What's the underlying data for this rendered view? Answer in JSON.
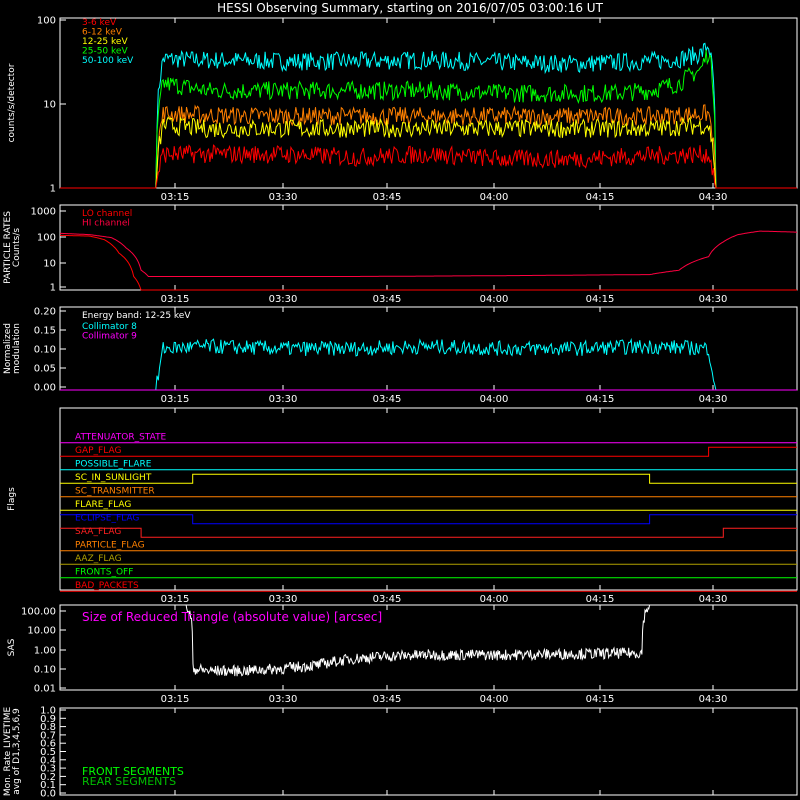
{
  "title": "HESSI Observing Summary, starting on 2016/07/05 03:00:16 UT",
  "colors": {
    "background": "#000000",
    "axes": "#ffffff",
    "red": "#ff0000",
    "orange": "#ff8000",
    "yellow": "#ffff00",
    "green": "#00ff00",
    "cyan": "#00ffff",
    "magenta": "#ff00ff",
    "crimson": "#ff0040",
    "blue": "#0000ff",
    "olive": "#b0a000",
    "darkgreen": "#00c000",
    "flagred": "#ff2020"
  },
  "time_ticks": [
    "03:15",
    "03:30",
    "03:45",
    "04:00",
    "04:15",
    "04:30"
  ],
  "chart_data": [
    {
      "id": "counts",
      "type": "line",
      "ylabel": "counts/s/detector",
      "yscale": "log",
      "ylim": [
        1,
        100
      ],
      "yticks": [
        "1",
        "10",
        "100"
      ],
      "xlim_minutes": [
        0,
        100
      ],
      "legend": [
        {
          "name": "3-6 keV",
          "color": "red"
        },
        {
          "name": "6-12 keV",
          "color": "orange"
        },
        {
          "name": "12-25 keV",
          "color": "yellow"
        },
        {
          "name": "25-50 keV",
          "color": "green"
        },
        {
          "name": "50-100 keV",
          "color": "cyan"
        }
      ],
      "legend_position": "top-left",
      "series": [
        {
          "name": "50-100 keV",
          "color": "cyan",
          "x": [
            0,
            13,
            14,
            20,
            30,
            40,
            50,
            60,
            70,
            75,
            80,
            84,
            87,
            88,
            89,
            100
          ],
          "y": [
            1,
            1,
            33,
            32,
            31,
            31,
            32,
            30,
            29,
            30,
            31,
            33,
            38,
            48,
            1,
            1
          ]
        },
        {
          "name": "25-50 keV",
          "color": "green",
          "x": [
            0,
            13,
            14,
            20,
            30,
            40,
            50,
            60,
            70,
            75,
            80,
            84,
            87,
            88,
            89,
            100
          ],
          "y": [
            1,
            1,
            17,
            14,
            14,
            14,
            14,
            13,
            13,
            13,
            14,
            17,
            25,
            40,
            1,
            1
          ]
        },
        {
          "name": "12-25 keV",
          "color": "orange",
          "x": [
            0,
            13,
            14,
            20,
            30,
            40,
            50,
            60,
            70,
            80,
            88,
            89,
            100
          ],
          "y": [
            1,
            1,
            7.5,
            7.2,
            7,
            7,
            7,
            7,
            7,
            7,
            7.5,
            1,
            1
          ]
        },
        {
          "name": "6-12 keV",
          "color": "yellow",
          "x": [
            0,
            13,
            14,
            20,
            30,
            40,
            50,
            60,
            70,
            80,
            88,
            89,
            100
          ],
          "y": [
            1,
            1,
            5.5,
            5,
            5,
            5,
            5,
            5,
            5,
            5,
            5.5,
            1,
            1
          ]
        },
        {
          "name": "3-6 keV",
          "color": "red",
          "x": [
            0,
            13,
            14,
            20,
            30,
            40,
            50,
            60,
            70,
            80,
            88,
            89,
            100
          ],
          "y": [
            1,
            1,
            2.5,
            2.5,
            2.5,
            2.3,
            2.5,
            2.2,
            2.2,
            2.4,
            2.5,
            1,
            1
          ]
        }
      ]
    },
    {
      "id": "particles",
      "type": "line",
      "ylabel": "PARTICLE RATES\nCounts/s",
      "yscale": "log",
      "ylim": [
        1,
        1000
      ],
      "yticks": [
        "1",
        "10",
        "100",
        "1000"
      ],
      "xlim_minutes": [
        0,
        100
      ],
      "legend": [
        {
          "name": "LO channel",
          "color": "red"
        },
        {
          "name": "HI channel",
          "color": "crimson"
        }
      ],
      "legend_position": "top-left",
      "series": [
        {
          "name": "LO channel",
          "color": "red",
          "x": [
            0,
            4,
            6,
            8,
            10,
            11,
            12,
            100
          ],
          "y": [
            85,
            80,
            60,
            20,
            3,
            1,
            1,
            1
          ]
        },
        {
          "name": "HI channel",
          "color": "crimson",
          "x": [
            0,
            4,
            7,
            9,
            11,
            12,
            20,
            40,
            60,
            80,
            84,
            88,
            90,
            92,
            95,
            100
          ],
          "y": [
            100,
            90,
            70,
            30,
            5,
            3,
            3,
            3,
            3.2,
            3.5,
            5,
            15,
            50,
            90,
            120,
            110
          ]
        }
      ]
    },
    {
      "id": "modulation",
      "type": "line",
      "ylabel": "Normalized\nmodulation",
      "ylim": [
        0,
        0.2
      ],
      "yticks": [
        "0.00",
        "0.05",
        "0.10",
        "0.15",
        "0.20"
      ],
      "xlim_minutes": [
        0,
        100
      ],
      "annotation": "Energy band: 12-25 keV",
      "legend": [
        {
          "name": "Collimator 8",
          "color": "cyan"
        },
        {
          "name": "Collimator 9",
          "color": "magenta"
        }
      ],
      "legend_position": "top-left",
      "series": [
        {
          "name": "Collimator 8",
          "color": "cyan",
          "x": [
            0,
            13,
            14,
            20,
            30,
            40,
            50,
            60,
            70,
            80,
            88,
            89,
            100
          ],
          "y": [
            0,
            0,
            0.1,
            0.105,
            0.1,
            0.1,
            0.105,
            0.1,
            0.1,
            0.105,
            0.1,
            0,
            0
          ]
        },
        {
          "name": "Collimator 9",
          "color": "magenta",
          "x": [
            0,
            100
          ],
          "y": [
            0,
            0
          ]
        }
      ]
    },
    {
      "id": "flags",
      "type": "line",
      "ylabel": "Flags",
      "xlim_minutes": [
        0,
        100
      ],
      "flags": [
        {
          "name": "ATTENUATOR_STATE",
          "color": "magenta",
          "x": [
            0,
            100
          ],
          "y": [
            0,
            0
          ]
        },
        {
          "name": "GAP_FLAG",
          "color": "red",
          "x": [
            0,
            88,
            88,
            100
          ],
          "y": [
            0,
            0,
            1,
            1
          ]
        },
        {
          "name": "POSSIBLE_FLARE",
          "color": "cyan",
          "x": [
            0,
            100
          ],
          "y": [
            0,
            0
          ]
        },
        {
          "name": "SC_IN_SUNLIGHT",
          "color": "yellow",
          "x": [
            0,
            18,
            18,
            80,
            80,
            100
          ],
          "y": [
            0,
            0,
            1,
            1,
            0,
            0
          ]
        },
        {
          "name": "SC_TRANSMITTER",
          "color": "orange",
          "x": [
            0,
            100
          ],
          "y": [
            0,
            0
          ]
        },
        {
          "name": "FLARE_FLAG",
          "color": "yellow",
          "x": [
            0,
            100
          ],
          "y": [
            0,
            0
          ]
        },
        {
          "name": "ECLIPSE_FLAG",
          "color": "blue",
          "x": [
            0,
            18,
            18,
            80,
            80,
            100
          ],
          "y": [
            1,
            1,
            0,
            0,
            1,
            1
          ]
        },
        {
          "name": "SAA_FLAG",
          "color": "flagred",
          "x": [
            0,
            11,
            11,
            90,
            90,
            100
          ],
          "y": [
            1,
            1,
            0,
            0,
            1,
            1
          ]
        },
        {
          "name": "PARTICLE_FLAG",
          "color": "orange",
          "x": [
            0,
            100
          ],
          "y": [
            0,
            0
          ]
        },
        {
          "name": "AAZ_FLAG",
          "color": "olive",
          "x": [
            0,
            100
          ],
          "y": [
            0,
            0
          ]
        },
        {
          "name": "FRONTS_OFF",
          "color": "green",
          "x": [
            0,
            100
          ],
          "y": [
            0,
            0
          ]
        },
        {
          "name": "BAD_PACKETS",
          "color": "red",
          "x": [
            0,
            100
          ],
          "y": [
            0,
            0
          ]
        }
      ]
    },
    {
      "id": "sas",
      "type": "line",
      "ylabel": "SAS",
      "yscale": "log",
      "ylim": [
        0.01,
        100
      ],
      "yticks": [
        "0.01",
        "0.10",
        "1.00",
        "10.00",
        "100.00"
      ],
      "xlim_minutes": [
        0,
        100
      ],
      "annotation": "Size of Reduced Triangle (absolute value) [arcsec]",
      "series": [
        {
          "name": "triangle",
          "color": "axes",
          "x": [
            17,
            18,
            20,
            25,
            30,
            35,
            40,
            45,
            50,
            60,
            70,
            79,
            80
          ],
          "y": [
            100,
            0.1,
            0.08,
            0.08,
            0.1,
            0.15,
            0.3,
            0.4,
            0.45,
            0.45,
            0.5,
            0.55,
            100
          ]
        }
      ]
    },
    {
      "id": "livetime",
      "type": "line",
      "ylabel": "Mon. Rate LIVETIME\navg of D1,3,4,5,6,9",
      "ylim": [
        0,
        1.0
      ],
      "yticks": [
        "0.0",
        "0.1",
        "0.2",
        "0.3",
        "0.4",
        "0.5",
        "0.6",
        "0.7",
        "0.8",
        "0.9",
        "1.0"
      ],
      "xlim_minutes": [
        0,
        100
      ],
      "legend": [
        {
          "name": "FRONT SEGMENTS",
          "color": "green"
        },
        {
          "name": "REAR SEGMENTS",
          "color": "darkgreen"
        }
      ],
      "legend_position": "bottom-left",
      "series": []
    }
  ]
}
